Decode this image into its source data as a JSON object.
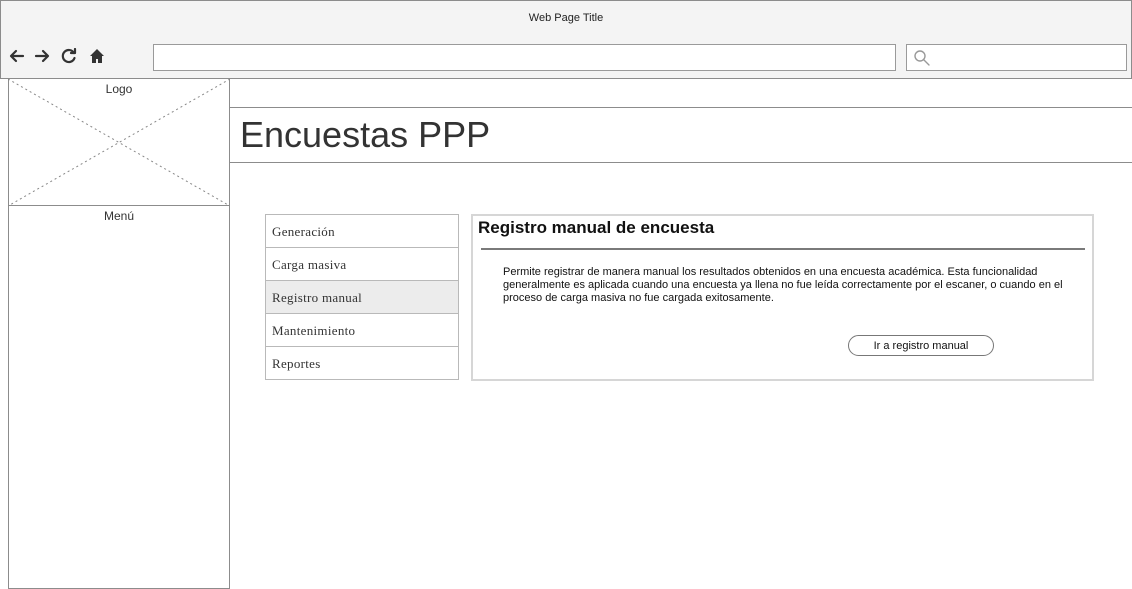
{
  "window": {
    "title": "Web Page Title"
  },
  "toolbar": {
    "buttons": [
      {
        "name": "back-button",
        "icon": "arrow-left-icon"
      },
      {
        "name": "forward-button",
        "icon": "arrow-right-icon"
      },
      {
        "name": "reload-button",
        "icon": "reload-icon"
      },
      {
        "name": "home-button",
        "icon": "home-icon"
      }
    ],
    "url_value": "",
    "search_value": ""
  },
  "sidebar": {
    "logo_label": "Logo",
    "menu_label": "Menú"
  },
  "header": {
    "title": "Encuestas PPP"
  },
  "nav": {
    "items": [
      {
        "label": "Generación",
        "selected": false
      },
      {
        "label": "Carga masiva",
        "selected": false
      },
      {
        "label": "Registro manual",
        "selected": true
      },
      {
        "label": "Mantenimiento",
        "selected": false
      },
      {
        "label": "Reportes",
        "selected": false
      }
    ]
  },
  "panel": {
    "title": "Registro manual de encuesta",
    "description": " Permite registrar de manera manual los resultados obtenidos en una encuesta académica. Esta funcionalidad generalmente es aplicada cuando una encuesta ya llena no fue leída correctamente por el escaner, o cuando en el proceso de carga masiva no fue cargada exitosamente.",
    "button_label": "Ir a registro manual"
  },
  "colors": {
    "chrome_bg": "#f4f4f4",
    "border": "#8c8c8c",
    "selected_item": "#ececec",
    "panel_border": "#d6d6d6"
  }
}
